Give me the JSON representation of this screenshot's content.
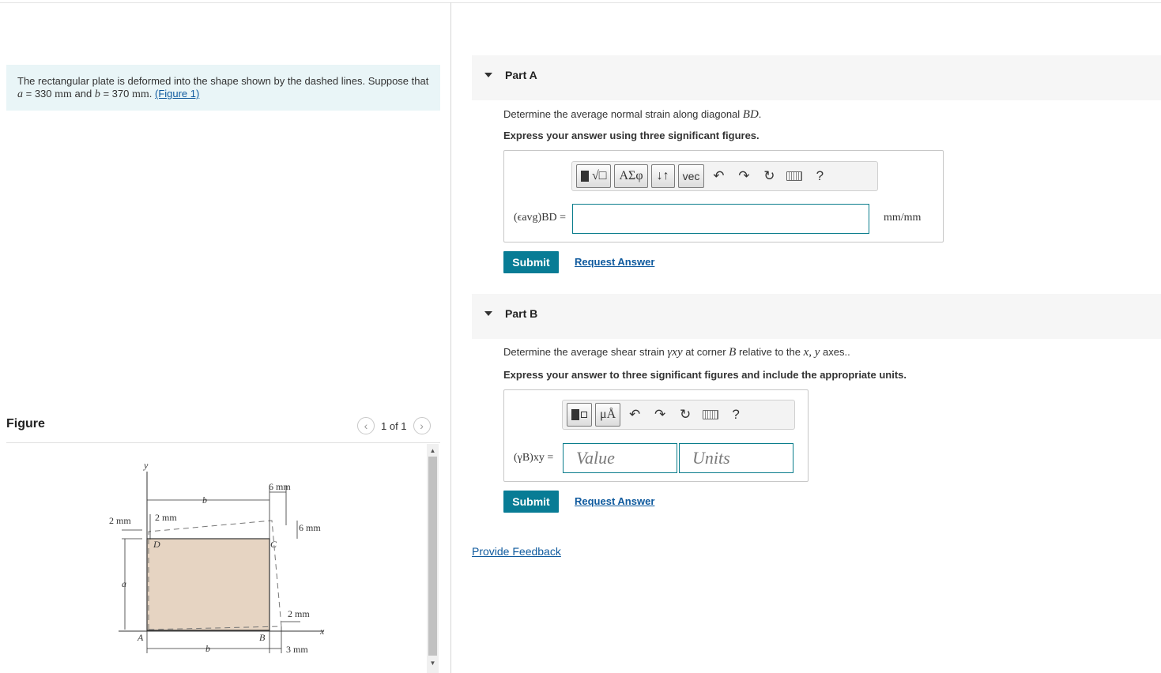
{
  "problem": {
    "text_1": "The rectangular plate is deformed into the shape shown by the dashed lines. Suppose that",
    "a_var": "a",
    "eq_1": " = 330 ",
    "unit_1": "mm",
    "and": " and ",
    "b_var": "b",
    "eq_2": " = 370 ",
    "unit_2": "mm",
    "period": ".",
    "figure_link": "(Figure 1)"
  },
  "figure": {
    "title": "Figure",
    "pager": "1 of 1",
    "prev_icon": "chevron-left-icon",
    "next_icon": "chevron-right-icon",
    "labels": {
      "y": "y",
      "x": "x",
      "b_top": "b",
      "b_bottom": "b",
      "a": "a",
      "A": "A",
      "B": "B",
      "C": "C",
      "D": "D",
      "mm_2_left": "2 mm",
      "mm_2_top": "2 mm",
      "mm_6_top": "6 mm",
      "mm_6_right": "6 mm",
      "mm_2_bottom": "2 mm",
      "mm_3": "3 mm"
    },
    "colors": {
      "plate": "#e6d4c2",
      "outline": "#333333"
    }
  },
  "partA": {
    "label": "Part A",
    "question_pre": "Determine the average normal strain along diagonal ",
    "question_math": "BD",
    "question_post": ".",
    "instruction": "Express your answer using three significant figures.",
    "toolbar": {
      "template_btn": "√□",
      "greek_btn": "ΑΣφ",
      "arrows_btn": "↓↑",
      "vec_btn": "vec",
      "undo_icon": "undo-icon",
      "redo_icon": "redo-icon",
      "reset_icon": "reset-icon",
      "keyboard_icon": "keyboard-icon",
      "help": "?"
    },
    "answer_label": "(ϵavg)BD =",
    "answer_value": "",
    "unit": "mm/mm",
    "submit": "Submit",
    "request": "Request Answer"
  },
  "partB": {
    "label": "Part B",
    "question_pre": "Determine the average shear strain ",
    "question_math_1": "γxy",
    "question_mid": " at corner ",
    "question_math_2": "B",
    "question_mid2": " relative to the ",
    "question_math_3": "x, y",
    "question_post": " axes..",
    "instruction": "Express your answer to three significant figures and include the appropriate units.",
    "toolbar": {
      "template_btn": "▯▯",
      "units_btn": "μÅ",
      "undo_icon": "undo-icon",
      "redo_icon": "redo-icon",
      "reset_icon": "reset-icon",
      "keyboard_icon": "keyboard-icon",
      "help": "?"
    },
    "answer_label": "(γB)xy =",
    "value_placeholder": "Value",
    "units_placeholder": "Units",
    "submit": "Submit",
    "request": "Request Answer"
  },
  "feedback": "Provide Feedback",
  "colors": {
    "accent": "#087c95",
    "link": "#0f5a9e",
    "problem_bg": "#e9f5f7",
    "part_header_bg": "#f6f6f6"
  }
}
